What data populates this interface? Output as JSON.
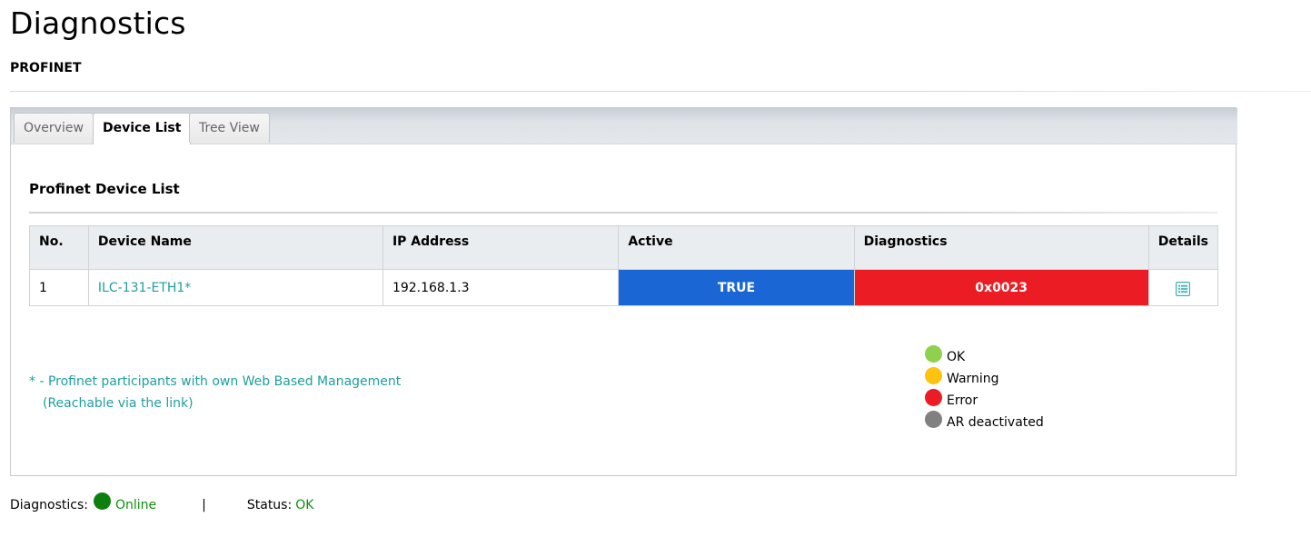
{
  "page": {
    "title": "Diagnostics",
    "subtitle": "PROFINET"
  },
  "tabs": [
    {
      "label": "Overview",
      "active": false
    },
    {
      "label": "Device List",
      "active": true
    },
    {
      "label": "Tree View",
      "active": false
    }
  ],
  "device_list": {
    "title": "Profinet Device List",
    "columns": [
      "No.",
      "Device Name",
      "IP Address",
      "Active",
      "Diagnostics",
      "Details"
    ],
    "rows": [
      {
        "no": "1",
        "device_name": "ILC-131-ETH1*",
        "ip_address": "192.168.1.3",
        "active": "TRUE",
        "diagnostics": "0x0023",
        "details_icon": "details-list-icon"
      }
    ],
    "colors": {
      "active_bg": "#1a66d4",
      "diagnostics_bg": "#ec1c24",
      "link": "#1f9e9e"
    }
  },
  "footnote": {
    "line1": "* - Profinet participants with own Web Based Management",
    "line2": "(Reachable via the link)"
  },
  "legend": [
    {
      "label": "OK",
      "color": "#8fd14f"
    },
    {
      "label": "Warning",
      "color": "#ffc20e"
    },
    {
      "label": "Error",
      "color": "#ec1c24"
    },
    {
      "label": "AR deactivated",
      "color": "#808080"
    }
  ],
  "status_bar": {
    "diagnostics_label": "Diagnostics:",
    "diagnostics_value": "Online",
    "diagnostics_color": "#0e7f0e",
    "separator": "|",
    "status_label": "Status:",
    "status_value": "OK"
  }
}
